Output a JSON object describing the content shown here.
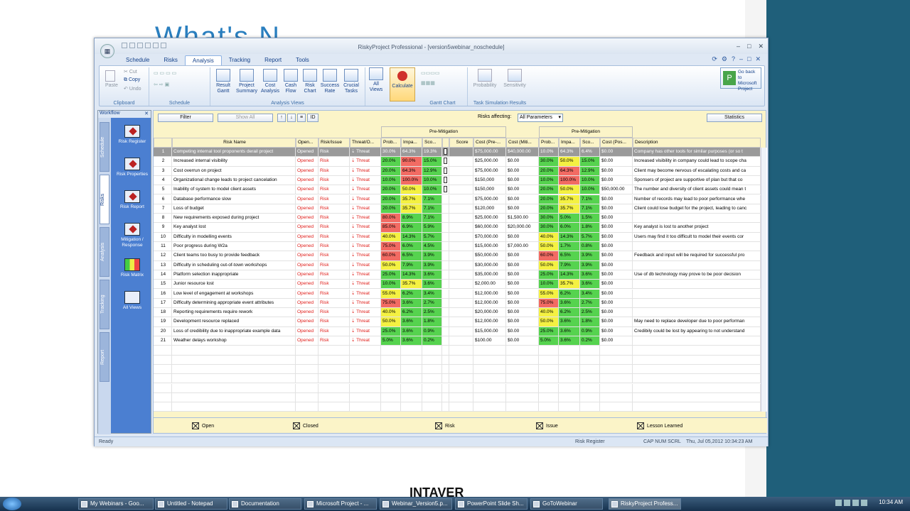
{
  "background": {
    "title": "What's N",
    "logo": "INTAVER"
  },
  "window": {
    "title": "RiskyProject Professional - [version5webinar_noschedule]",
    "controls": [
      "–",
      "□",
      "✕"
    ]
  },
  "tabs": [
    "Schedule",
    "Risks",
    "Analysis",
    "Tracking",
    "Report",
    "Tools"
  ],
  "ribbon": {
    "clipboard": {
      "paste": "Paste",
      "cut": "Cut",
      "copy": "Copy",
      "undo": "Undo",
      "label": "Clipboard"
    },
    "schedule": {
      "label": "Schedule"
    },
    "analysis_views": {
      "label": "Analysis Views",
      "buttons": [
        "Result Gantt",
        "Project Summary",
        "Cost Analysis",
        "Cash Flow",
        "Risk Chart",
        "Success Rate",
        "Crucial Tasks"
      ]
    },
    "all_views": "All Views",
    "calculate": "Calculate",
    "gantt_chart": "Gantt Chart",
    "task_sim": {
      "label": "Task Simulation Results",
      "prob": "Probability",
      "sens": "Sensitivity"
    },
    "go_back": "Go back to Microsoft Project"
  },
  "workflow": {
    "title": "Workflow",
    "vtabs": [
      "Schedule",
      "Risks",
      "Analysis",
      "Tracking",
      "Report"
    ],
    "items": [
      "Risk Register",
      "Risk Properties",
      "Risk Report",
      "Mitigation / Response",
      "Risk Matrix",
      "All Views"
    ]
  },
  "toolbar": {
    "filter": "Filter",
    "show_all": "Show All",
    "risks_affecting": "Risks affecting:",
    "affecting_value": "All Parameters",
    "statistics": "Statistics"
  },
  "headers": {
    "pre_mitigation": "Pre-Mitigation",
    "post_mitigation": "Pre-Mitigation",
    "columns": [
      "",
      "Risk Name",
      "Open...",
      "Risk/Issue",
      "Threat/O...",
      "Prob...",
      "Impa...",
      "Sco...",
      "",
      "Score",
      "Cost (Pre-...",
      "Cost (Miti...",
      "Prob...",
      "Impa...",
      "Sco...",
      "Cost (Pos...",
      "Description"
    ]
  },
  "rows": [
    {
      "id": "1",
      "name": "Competing internal tool proponents derail project",
      "open": "Opened",
      "type": "Risk",
      "threat": "Threat",
      "p": "30.0%",
      "i": "64.3%",
      "s": "19.3%",
      "cost": "$75,000.00",
      "mit": "$40,000.00",
      "pp": "10.0%",
      "pi": "64.3%",
      "ps": "6.4%",
      "pc": "$0.00",
      "desc": "Company has other tools for similar purposes (or so t"
    },
    {
      "id": "2",
      "name": "Increased internal visibility",
      "open": "Opened",
      "type": "Risk",
      "threat": "Threat",
      "p": "20.0%",
      "i": "90.0%",
      "s": "15.0%",
      "cost": "$25,000.00",
      "mit": "$0.00",
      "pp": "30.0%",
      "pi": "50.0%",
      "ps": "15.0%",
      "pc": "$0.00",
      "desc": "Increased visibility in company could lead to scope cha"
    },
    {
      "id": "3",
      "name": "Cost overrun on project",
      "open": "Opened",
      "type": "Risk",
      "threat": "Threat",
      "p": "20.0%",
      "i": "64.3%",
      "s": "12.9%",
      "cost": "$75,000.00",
      "mit": "$0.00",
      "pp": "20.0%",
      "pi": "64.3%",
      "ps": "12.9%",
      "pc": "$0.00",
      "desc": "Client may become nervous of escalating costs and ca"
    },
    {
      "id": "4",
      "name": "Organizational change leads to project cancelation",
      "open": "Opened",
      "type": "Risk",
      "threat": "Threat",
      "p": "10.0%",
      "i": "100.0%",
      "s": "10.0%",
      "cost": "$150,000",
      "mit": "$0.00",
      "pp": "10.0%",
      "pi": "100.0%",
      "ps": "10.0%",
      "pc": "$0.00",
      "desc": "Sponsers of project are supportive of plan but that co"
    },
    {
      "id": "5",
      "name": "Inability of system to model client assets",
      "open": "Opened",
      "type": "Risk",
      "threat": "Threat",
      "p": "20.0%",
      "i": "50.0%",
      "s": "10.0%",
      "cost": "$150,000",
      "mit": "$0.00",
      "pp": "20.0%",
      "pi": "50.0%",
      "ps": "10.0%",
      "pc": "$50,000.00",
      "desc": "The number and diversity of client assets could mean t"
    },
    {
      "id": "6",
      "name": "Database performance slow",
      "open": "Opened",
      "type": "Risk",
      "threat": "Threat",
      "p": "20.0%",
      "i": "35.7%",
      "s": "7.1%",
      "cost": "$75,000.00",
      "mit": "$0.00",
      "pp": "20.0%",
      "pi": "35.7%",
      "ps": "7.1%",
      "pc": "$0.00",
      "desc": "Number of records may lead to poor performance whe"
    },
    {
      "id": "7",
      "name": "Loss of budget",
      "open": "Opened",
      "type": "Risk",
      "threat": "Threat",
      "p": "20.0%",
      "i": "35.7%",
      "s": "7.1%",
      "cost": "$120,000",
      "mit": "$0.00",
      "pp": "20.0%",
      "pi": "35.7%",
      "ps": "7.1%",
      "pc": "$0.00",
      "desc": "Client could lose budget for the project, leading to canc"
    },
    {
      "id": "8",
      "name": "New requirements exposed during project",
      "open": "Opened",
      "type": "Risk",
      "threat": "Threat",
      "p": "80.0%",
      "i": "8.9%",
      "s": "7.1%",
      "cost": "$25,000.00",
      "mit": "$1,500.00",
      "pp": "30.0%",
      "pi": "5.0%",
      "ps": "1.5%",
      "pc": "$0.00",
      "desc": ""
    },
    {
      "id": "9",
      "name": "Key analyst lost",
      "open": "Opened",
      "type": "Risk",
      "threat": "Threat",
      "p": "85.0%",
      "i": "6.9%",
      "s": "5.9%",
      "cost": "$60,000.00",
      "mit": "$20,000.00",
      "pp": "30.0%",
      "pi": "6.0%",
      "ps": "1.8%",
      "pc": "$0.00",
      "desc": "Key analyst is lost to another project"
    },
    {
      "id": "10",
      "name": "Difficulty in modelling events",
      "open": "Opened",
      "type": "Risk",
      "threat": "Threat",
      "p": "40.0%",
      "i": "14.3%",
      "s": "5.7%",
      "cost": "$70,000.00",
      "mit": "$0.00",
      "pp": "40.0%",
      "pi": "14.3%",
      "ps": "5.7%",
      "pc": "$0.00",
      "desc": "Users may find it too difficult to model their events cor"
    },
    {
      "id": "11",
      "name": "Poor progress during W2a",
      "open": "Opened",
      "type": "Risk",
      "threat": "Threat",
      "p": "75.0%",
      "i": "6.0%",
      "s": "4.5%",
      "cost": "$15,000.00",
      "mit": "$7,000.00",
      "pp": "50.0%",
      "pi": "1.7%",
      "ps": "0.8%",
      "pc": "$0.00",
      "desc": ""
    },
    {
      "id": "12",
      "name": "Client teams too busy to provide feedback",
      "open": "Opened",
      "type": "Risk",
      "threat": "Threat",
      "p": "60.0%",
      "i": "6.5%",
      "s": "3.9%",
      "cost": "$50,000.00",
      "mit": "$0.00",
      "pp": "60.0%",
      "pi": "6.5%",
      "ps": "3.9%",
      "pc": "$0.00",
      "desc": "Feedback and input will be required for successful pro"
    },
    {
      "id": "13",
      "name": "Difficulty in scheduling out-of-town workshops",
      "open": "Opened",
      "type": "Risk",
      "threat": "Threat",
      "p": "50.0%",
      "i": "7.9%",
      "s": "3.9%",
      "cost": "$30,000.00",
      "mit": "$0.00",
      "pp": "50.0%",
      "pi": "7.9%",
      "ps": "3.9%",
      "pc": "$0.00",
      "desc": ""
    },
    {
      "id": "14",
      "name": "Platform selection inappropriate",
      "open": "Opened",
      "type": "Risk",
      "threat": "Threat",
      "p": "25.0%",
      "i": "14.3%",
      "s": "3.6%",
      "cost": "$35,000.00",
      "mit": "$0.00",
      "pp": "25.0%",
      "pi": "14.3%",
      "ps": "3.6%",
      "pc": "$0.00",
      "desc": "Use of db technology may prove to be poor decision"
    },
    {
      "id": "15",
      "name": "Junior resource lost",
      "open": "Opened",
      "type": "Risk",
      "threat": "Threat",
      "p": "10.0%",
      "i": "35.7%",
      "s": "3.6%",
      "cost": "$2,000.00",
      "mit": "$0.00",
      "pp": "10.0%",
      "pi": "35.7%",
      "ps": "3.6%",
      "pc": "$0.00",
      "desc": ""
    },
    {
      "id": "16",
      "name": "Low level of engagement at workshops",
      "open": "Opened",
      "type": "Risk",
      "threat": "Threat",
      "p": "55.0%",
      "i": "6.2%",
      "s": "3.4%",
      "cost": "$12,000.00",
      "mit": "$0.00",
      "pp": "55.0%",
      "pi": "6.2%",
      "ps": "3.4%",
      "pc": "$0.00",
      "desc": ""
    },
    {
      "id": "17",
      "name": "Difficulty determining appropriate event attributes",
      "open": "Opened",
      "type": "Risk",
      "threat": "Threat",
      "p": "75.0%",
      "i": "3.6%",
      "s": "2.7%",
      "cost": "$12,000.00",
      "mit": "$0.00",
      "pp": "75.0%",
      "pi": "3.6%",
      "ps": "2.7%",
      "pc": "$0.00",
      "desc": ""
    },
    {
      "id": "18",
      "name": "Reporting requirements require rework",
      "open": "Opened",
      "type": "Risk",
      "threat": "Threat",
      "p": "40.0%",
      "i": "6.2%",
      "s": "2.5%",
      "cost": "$20,000.00",
      "mit": "$0.00",
      "pp": "40.0%",
      "pi": "6.2%",
      "ps": "2.5%",
      "pc": "$0.00",
      "desc": ""
    },
    {
      "id": "19",
      "name": "Development resource replaced",
      "open": "Opened",
      "type": "Risk",
      "threat": "Threat",
      "p": "50.0%",
      "i": "3.6%",
      "s": "1.8%",
      "cost": "$12,000.00",
      "mit": "$0.00",
      "pp": "50.0%",
      "pi": "3.6%",
      "ps": "1.8%",
      "pc": "$0.00",
      "desc": "May need to replace developer due to poor performan"
    },
    {
      "id": "20",
      "name": "Loss of credibility due to inappropriate example data",
      "open": "Opened",
      "type": "Risk",
      "threat": "Threat",
      "p": "25.0%",
      "i": "3.6%",
      "s": "0.9%",
      "cost": "$15,000.00",
      "mit": "$0.00",
      "pp": "25.0%",
      "pi": "3.6%",
      "ps": "0.9%",
      "pc": "$0.00",
      "desc": "Credibily could be lost by appearing to not understand"
    },
    {
      "id": "21",
      "name": "Weather delays workshop",
      "open": "Opened",
      "type": "Risk",
      "threat": "Threat",
      "p": "5.0%",
      "i": "3.6%",
      "s": "0.2%",
      "cost": "$100.00",
      "mit": "$0.00",
      "pp": "5.0%",
      "pi": "3.6%",
      "ps": "0.2%",
      "pc": "$0.00",
      "desc": ""
    }
  ],
  "legend": [
    "Open",
    "Closed",
    "Risk",
    "Issue",
    "Lesson Learned"
  ],
  "status": {
    "ready": "Ready",
    "view": "Risk Register",
    "caps": "CAP  NUM  SCRL",
    "datetime": "Thu, Jul 05,2012   10:34:23 AM"
  },
  "taskbar": {
    "items": [
      "My Webinars - Goo...",
      "Untitled - Notepad",
      "Documentation",
      "Microsoft Project - ...",
      "Webinar_Version5.p...",
      "PowerPoint Slide Sh...",
      "GoToWebinar",
      "RiskyProject Profess..."
    ],
    "clock": "10:34 AM"
  }
}
